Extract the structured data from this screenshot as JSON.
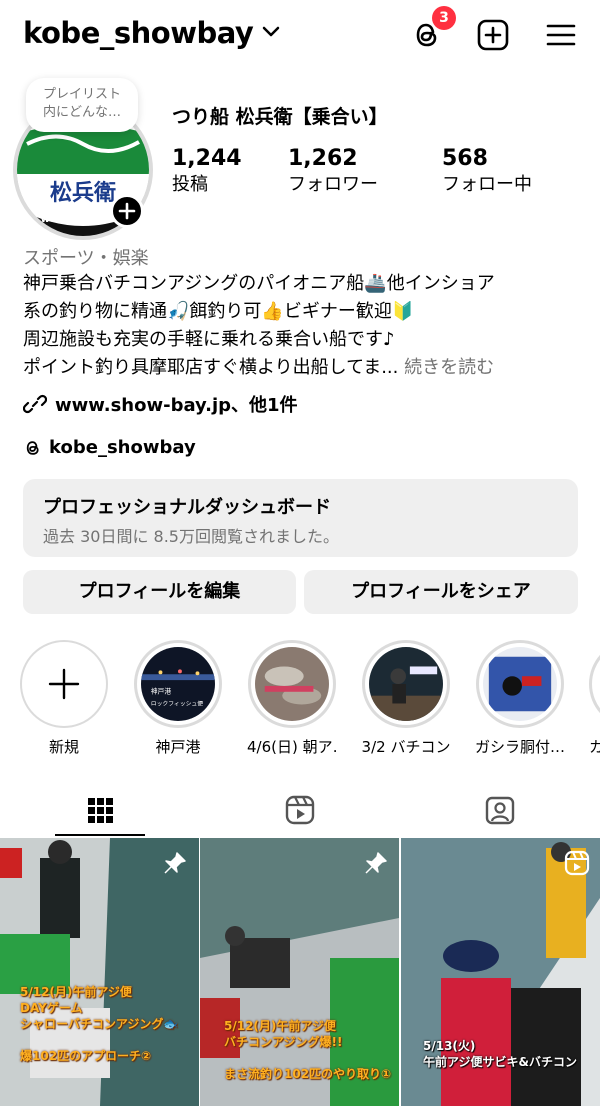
{
  "header": {
    "username": "kobe_showbay",
    "threads_badge_count": "3"
  },
  "profile": {
    "note": "プレイリスト\n内にどんな…",
    "display_name": "つり船 松兵衛【乗合い】",
    "avatar_text": "松兵衛",
    "avatar_url_snippet": "ww.show-ba",
    "stats": [
      {
        "value": "1,244",
        "label": "投稿"
      },
      {
        "value": "1,262",
        "label": "フォロワー"
      },
      {
        "value": "568",
        "label": "フォロー中"
      }
    ],
    "category": "スポーツ・娯楽",
    "bio_lines": [
      "神戸乗合バチコンアジングのパイオニア船🚢他インショア",
      "系の釣り物に精通🎣餌釣り可👍ビギナー歓迎🔰",
      "周辺施設も充実の手軽に乗れる乗合い船です♪",
      "ポイント釣り具摩耶店すぐ横より出船してま..."
    ],
    "bio_more": "続きを読む",
    "link": "www.show-bay.jp、他1件",
    "threads_handle": "kobe_showbay"
  },
  "dashboard": {
    "title": "プロフェッショナルダッシュボード",
    "subtitle": "過去 30日間に 8.5万回閲覧されました。"
  },
  "buttons": {
    "edit": "プロフィールを編集",
    "share": "プロフィールをシェア"
  },
  "highlights": [
    {
      "label": "新規"
    },
    {
      "label": "神戸港",
      "thumb_text_1": "神戸港",
      "thumb_text_2": "ロックフィッシュ便"
    },
    {
      "label": "4/6(日) 朝ア…"
    },
    {
      "label": "3/2 バチコン"
    },
    {
      "label": "ガシラ胴付…"
    },
    {
      "label": "カ"
    }
  ],
  "posts": [
    {
      "caption": [
        "5/12(月)午前アジ便",
        "DAYゲーム",
        "シャローバチコンアジング🐟",
        "",
        "爆102匹のアプローチ②"
      ],
      "pinned": true
    },
    {
      "caption": [
        "5/12(月)午前アジ便",
        "バチコンアジング爆!!",
        "",
        "まさ流釣り102匹のやり取り①"
      ],
      "pinned": true
    },
    {
      "caption": [
        "5/13(火)",
        "午前アジ便サビキ&バチコン"
      ],
      "reel": true
    }
  ],
  "colors": {
    "badge": "#ff3040",
    "secondary_text": "#737373",
    "button_bg": "#efefef",
    "caption": "#ffb020"
  }
}
